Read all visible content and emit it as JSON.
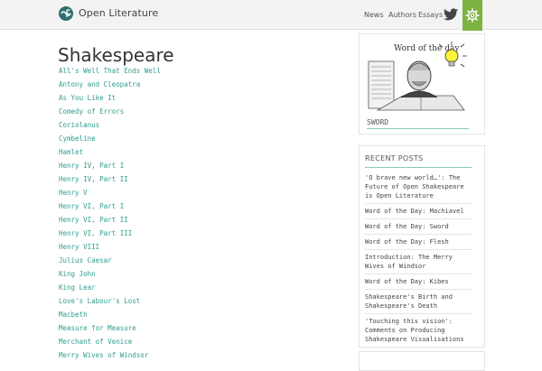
{
  "header": {
    "site_title": "Open Literature",
    "nav": [
      "News",
      "Authors",
      "Essays"
    ],
    "icons": [
      "open-literature-logo-icon",
      "twitter-icon",
      "gear-icon"
    ],
    "accent_color": "#7cb342"
  },
  "main": {
    "title": "Shakespeare",
    "link_color": "#2e9e8e",
    "plays": [
      "All's Well That Ends Well",
      "Antony and Cleopatra",
      "As You Like It",
      "Comedy of Errors",
      "Coriolanus",
      "Cymbeline",
      "Hamlet",
      "Henry IV, Part I",
      "Henry IV, Part II",
      "Henry V",
      "Henry VI, Part I",
      "Henry VI, Part II",
      "Henry VI, Part III",
      "Henry VIII",
      "Julius Caesar",
      "King John",
      "King Lear",
      "Love's Labour's Lost",
      "Macbeth",
      "Measure for Measure",
      "Merchant of Venice",
      "Merry Wives of Windsor"
    ]
  },
  "sidebar": {
    "word_widget": {
      "image_text": "Word of the day",
      "word": "SWORD"
    },
    "recent_posts": {
      "title": "RECENT POSTS",
      "items": [
        "'O brave new world…': The Future of Open Shakespeare is Open Literature",
        "Word of the Day: Machiavel",
        "Word of the Day: Sword",
        "Word of the Day: Flesh",
        "Introduction: The Merry Wives of Windsor",
        "Word of the Day: Kibes",
        "Shakespeare's Birth and Shakespeare's Death",
        "'Touching this vision': Comments on Producing Shakespeare Visualisations"
      ]
    }
  }
}
